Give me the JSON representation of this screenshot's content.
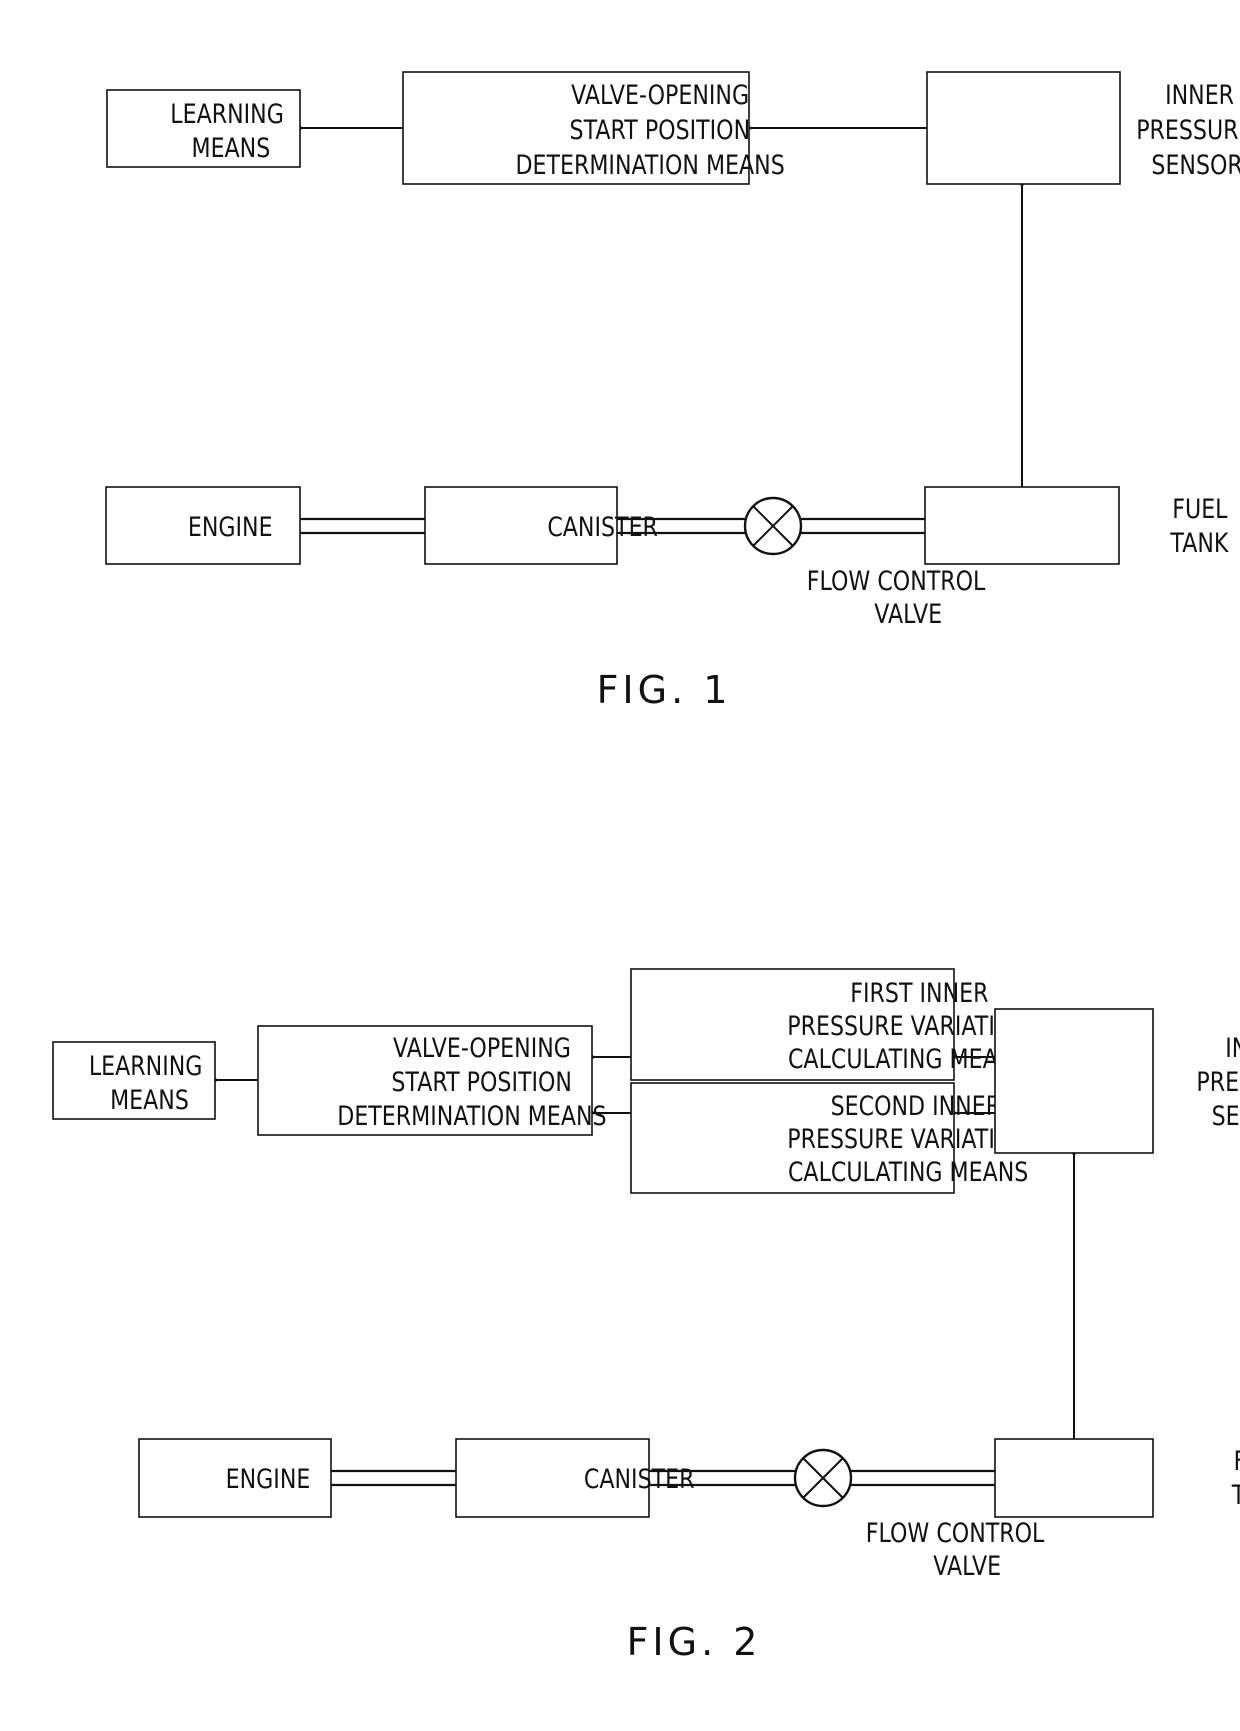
{
  "figures": [
    {
      "caption": "FIG. 1",
      "blocks": {
        "learning": [
          "LEARNING",
          "MEANS"
        ],
        "determination": [
          "VALVE-OPENING",
          "START POSITION",
          "DETERMINATION MEANS"
        ],
        "sensor": [
          "INNER",
          "PRESSURE",
          "SENSOR"
        ],
        "engine": [
          "ENGINE"
        ],
        "canister": [
          "CANISTER"
        ],
        "fuel_tank": [
          "FUEL",
          "TANK"
        ]
      },
      "valve_label": [
        "FLOW CONTROL",
        "VALVE"
      ]
    },
    {
      "caption": "FIG. 2",
      "blocks": {
        "learning": [
          "LEARNING",
          "MEANS"
        ],
        "determination": [
          "VALVE-OPENING",
          "START POSITION",
          "DETERMINATION MEANS"
        ],
        "first_calc": [
          "FIRST INNER",
          "PRESSURE VARIATION",
          "CALCULATING MEANS"
        ],
        "second_calc": [
          "SECOND INNER",
          "PRESSURE VARIATION",
          "CALCULATING MEANS"
        ],
        "sensor": [
          "INNER",
          "PRESSURE",
          "SENSOR"
        ],
        "engine": [
          "ENGINE"
        ],
        "canister": [
          "CANISTER"
        ],
        "fuel_tank": [
          "FUEL",
          "TANK"
        ]
      },
      "valve_label": [
        "FLOW CONTROL",
        "VALVE"
      ]
    }
  ]
}
